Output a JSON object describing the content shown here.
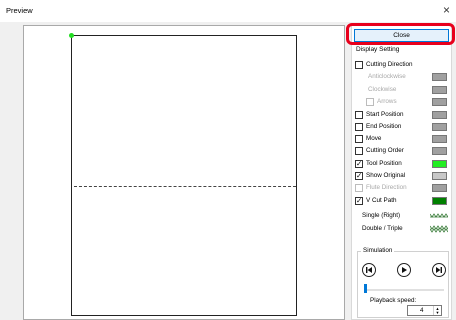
{
  "window": {
    "title": "Preview",
    "close_glyph": "×"
  },
  "panel": {
    "close_label": "Close",
    "display_setting_title": "Display Setting",
    "items": [
      {
        "label": "Cutting Direction",
        "checked": false,
        "enabled": true,
        "color": null
      },
      {
        "label": "Anticlockwise",
        "checked": null,
        "enabled": false,
        "color": "#a0a0a0"
      },
      {
        "label": "Clockwise",
        "checked": null,
        "enabled": false,
        "color": "#a0a0a0"
      },
      {
        "label": "Arrows",
        "checked": false,
        "enabled": false,
        "color": "#a0a0a0"
      },
      {
        "label": "Start Position",
        "checked": false,
        "enabled": true,
        "color": "#a0a0a0"
      },
      {
        "label": "End Position",
        "checked": false,
        "enabled": true,
        "color": "#a0a0a0"
      },
      {
        "label": "Move",
        "checked": false,
        "enabled": true,
        "color": "#a0a0a0"
      },
      {
        "label": "Cutting Order",
        "checked": false,
        "enabled": true,
        "color": "#a0a0a0"
      },
      {
        "label": "Tool Position",
        "checked": true,
        "enabled": true,
        "color": "#22ee22"
      },
      {
        "label": "Show Original",
        "checked": true,
        "enabled": true,
        "color": "#c8c8c8"
      },
      {
        "label": "Flute Direction",
        "checked": false,
        "enabled": false,
        "color": "#a0a0a0"
      },
      {
        "label": "V Cut Path",
        "checked": true,
        "enabled": true,
        "color": "#008000"
      }
    ],
    "legend": [
      {
        "label": "Single (Right)",
        "icon": "single-zigzag-icon"
      },
      {
        "label": "Double / Triple",
        "icon": "double-zigzag-icon"
      }
    ],
    "simulation": {
      "title": "Simulation",
      "controls": [
        "skip-to-start-icon",
        "play-icon",
        "skip-to-end-icon"
      ],
      "progress": 0,
      "speed_label": "Playback speed:",
      "speed_value": "4"
    }
  },
  "colors": {
    "accent": "#0078d7",
    "highlight": "#e8001c",
    "tool_dot": "#22dd22"
  }
}
